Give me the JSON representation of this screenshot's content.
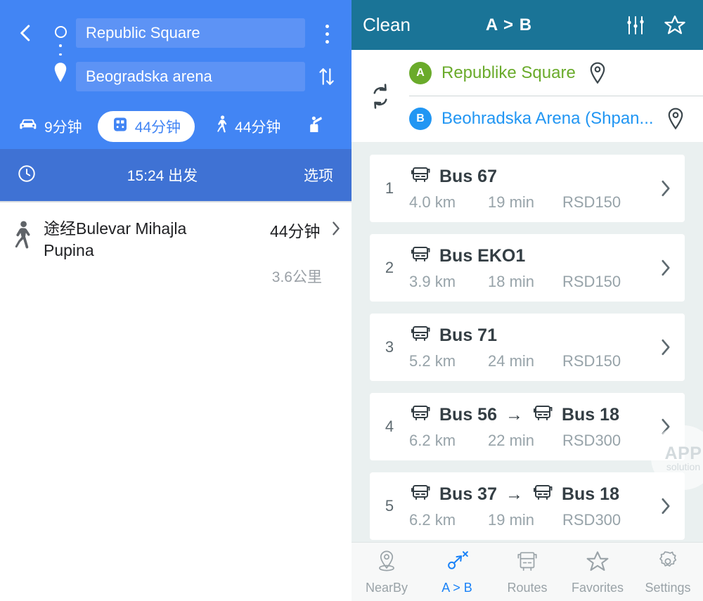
{
  "maps": {
    "back_icon": "back-arrow-icon",
    "origin": {
      "value": "Republic Square",
      "marker": "origin-circle-icon"
    },
    "destination": {
      "value": "Beogradska arena",
      "marker": "destination-pin-icon"
    },
    "menu_icon": "kebab-menu-icon",
    "swap_icon": "swap-vertical-icon",
    "modes": [
      {
        "icon": "car-icon",
        "label": "9分钟",
        "active": false
      },
      {
        "icon": "transit-icon",
        "label": "44分钟",
        "active": true
      },
      {
        "icon": "walk-icon",
        "label": "44分钟",
        "active": false
      },
      {
        "icon": "rideshare-icon",
        "label": "",
        "active": false
      }
    ],
    "depart": {
      "clock_icon": "clock-icon",
      "text": "15:24 出发",
      "options_label": "选项"
    },
    "result": {
      "icon": "walking-person-icon",
      "title": "途经Bulevar Mihajla Pupina",
      "duration": "44分钟",
      "distance": "3.6公里",
      "chevron_icon": "chevron-right-icon"
    }
  },
  "transit": {
    "header": {
      "clean_label": "Clean",
      "title": "A > B",
      "filter_icon": "sliders-icon",
      "favorite_icon": "star-outline-icon"
    },
    "endpoints": {
      "swap_icon": "swap-circular-arrows-icon",
      "items": [
        {
          "badge": "A",
          "badge_color": "#6aab2b",
          "name": "Republike Square",
          "name_color": "#6aab2b",
          "pin_icon": "map-pin-icon"
        },
        {
          "badge": "B",
          "badge_color": "#2196f3",
          "name": "Beohradska Arena (Shpan...",
          "name_color": "#2196f3",
          "pin_icon": "map-pin-icon"
        }
      ]
    },
    "routes": [
      {
        "index": "1",
        "legs": [
          {
            "icon": "bus-icon",
            "name": "Bus 67"
          }
        ],
        "distance": "4.0 km",
        "duration": "19 min",
        "fare": "RSD150",
        "chevron_icon": "chevron-right-icon"
      },
      {
        "index": "2",
        "legs": [
          {
            "icon": "bus-icon",
            "name": "Bus EKO1"
          }
        ],
        "distance": "3.9 km",
        "duration": "18 min",
        "fare": "RSD150",
        "chevron_icon": "chevron-right-icon"
      },
      {
        "index": "3",
        "legs": [
          {
            "icon": "bus-icon",
            "name": "Bus 71"
          }
        ],
        "distance": "5.2 km",
        "duration": "24 min",
        "fare": "RSD150",
        "chevron_icon": "chevron-right-icon"
      },
      {
        "index": "4",
        "legs": [
          {
            "icon": "bus-icon",
            "name": "Bus 56"
          },
          {
            "icon": "bus-icon",
            "name": "Bus 18"
          }
        ],
        "arrow": "→",
        "distance": "6.2 km",
        "duration": "22 min",
        "fare": "RSD300",
        "chevron_icon": "chevron-right-icon"
      },
      {
        "index": "5",
        "legs": [
          {
            "icon": "bus-icon",
            "name": "Bus 37"
          },
          {
            "icon": "bus-icon",
            "name": "Bus 18"
          }
        ],
        "arrow": "→",
        "distance": "6.2 km",
        "duration": "19 min",
        "fare": "RSD300",
        "chevron_icon": "chevron-right-icon"
      }
    ],
    "watermark": {
      "line1": "APP",
      "line2": "solution"
    },
    "tabs": [
      {
        "icon": "nearby-pin-icon",
        "label": "NearBy",
        "active": false
      },
      {
        "icon": "route-ab-icon",
        "label": "A > B",
        "active": true
      },
      {
        "icon": "bus-front-icon",
        "label": "Routes",
        "active": false
      },
      {
        "icon": "star-outline-icon",
        "label": "Favorites",
        "active": false
      },
      {
        "icon": "gear-icon",
        "label": "Settings",
        "active": false
      }
    ]
  },
  "colors": {
    "maps_blue": "#4285f4",
    "maps_blue_dark": "#3f72d4",
    "maps_field": "#5d93f5",
    "transit_teal": "#1a7497",
    "list_bg": "#eaf0f0",
    "accent_blue": "#1a82f7",
    "green": "#6aab2b"
  }
}
